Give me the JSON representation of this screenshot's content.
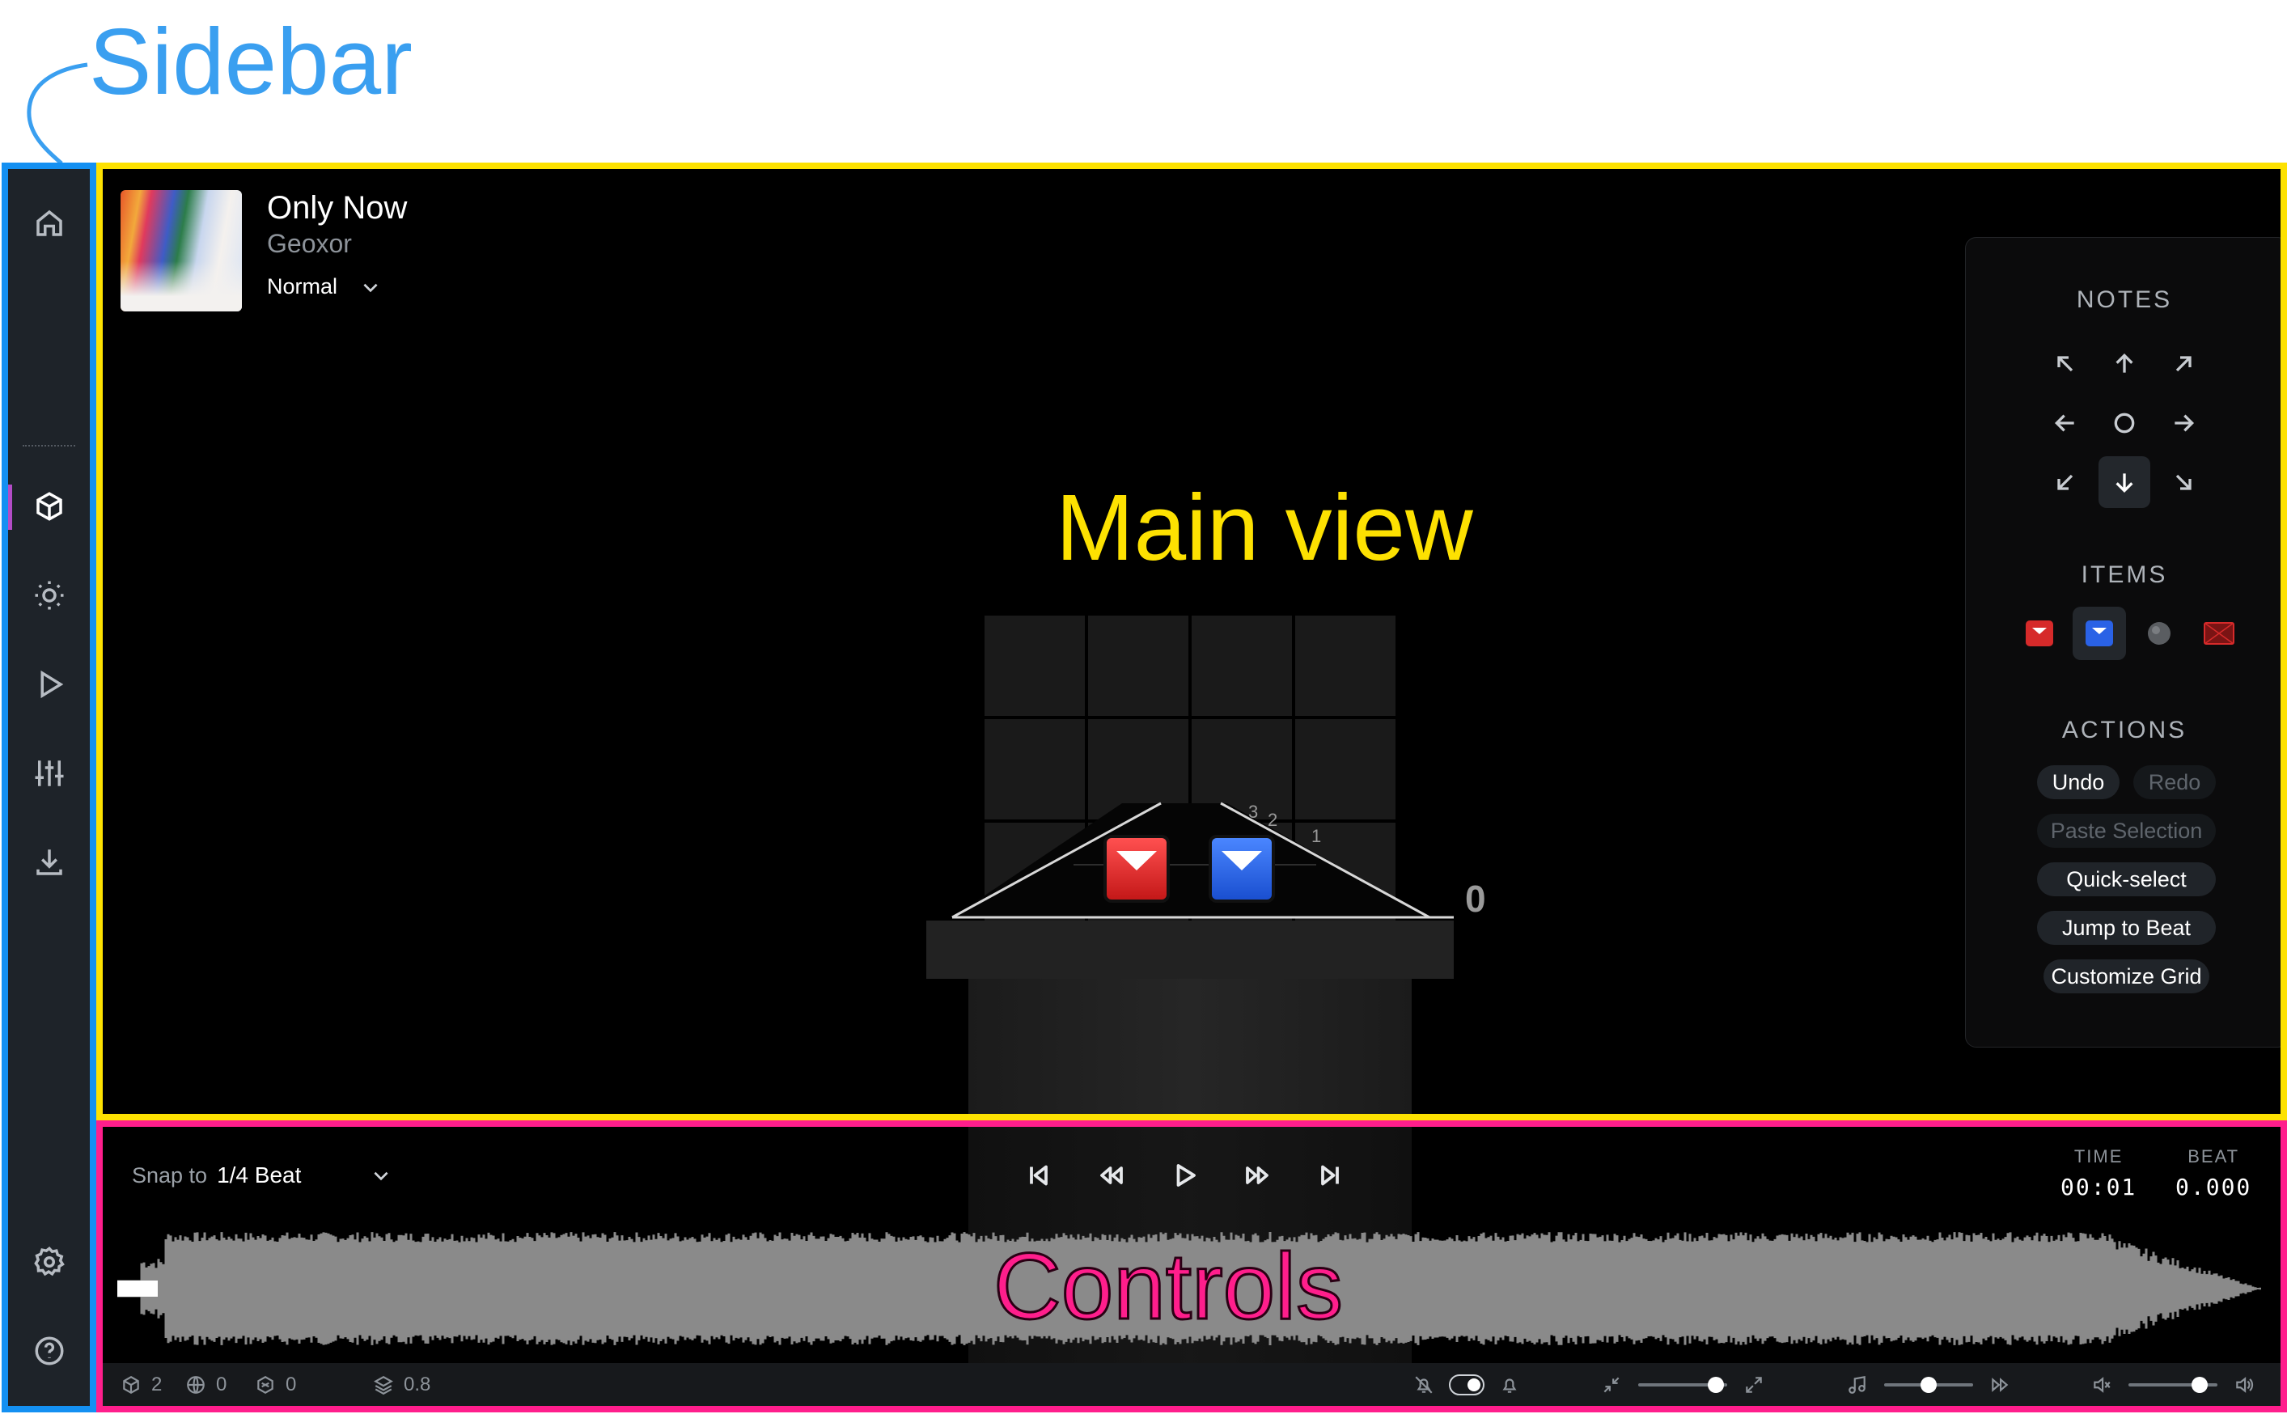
{
  "annotations": {
    "sidebar": "Sidebar",
    "main_view": "Main view",
    "controls": "Controls",
    "colors": {
      "sidebar": "#1490f2",
      "main_view": "#fde101",
      "controls": "#ff1e8c"
    }
  },
  "sidebar": {
    "items": [
      {
        "icon": "home-icon",
        "active": false
      },
      {
        "icon": "cube-icon",
        "active": true
      },
      {
        "icon": "sun-icon",
        "active": false
      },
      {
        "icon": "play-icon",
        "active": false
      },
      {
        "icon": "sliders-icon",
        "active": false
      },
      {
        "icon": "download-icon",
        "active": false
      }
    ],
    "bottom_items": [
      {
        "icon": "gear-icon"
      },
      {
        "icon": "help-icon"
      }
    ]
  },
  "song": {
    "title": "Only Now",
    "artist": "Geoxor",
    "difficulty": "Normal"
  },
  "scene": {
    "current_beat_label": "0",
    "lane_numbers": [
      "3",
      "2",
      "1"
    ]
  },
  "tools": {
    "notes_header": "NOTES",
    "items_header": "ITEMS",
    "actions_header": "ACTIONS",
    "directions": [
      "up-left",
      "up",
      "up-right",
      "left",
      "any",
      "right",
      "down-left",
      "down",
      "down-right"
    ],
    "selected_direction": "down",
    "items": [
      "red-block",
      "blue-block",
      "bomb",
      "obstacle"
    ],
    "selected_item": "blue-block",
    "actions": {
      "undo": "Undo",
      "redo": "Redo",
      "paste_selection": "Paste Selection",
      "quick_select": "Quick-select",
      "jump_to_beat": "Jump to Beat",
      "customize_grid": "Customize Grid"
    }
  },
  "controls": {
    "snap_label": "Snap to",
    "snap_value": "1/4 Beat",
    "time_label": "TIME",
    "time_value": "00:01",
    "beat_label": "BEAT",
    "beat_value": "0.000"
  },
  "status": {
    "notes_count": "2",
    "events_count": "0",
    "obstacles_count": "0",
    "opacity_value": "0.8",
    "metronome_on": true,
    "zoom_level": 0.87,
    "playback_speed_level": 0.5,
    "volume_level": 0.8
  }
}
